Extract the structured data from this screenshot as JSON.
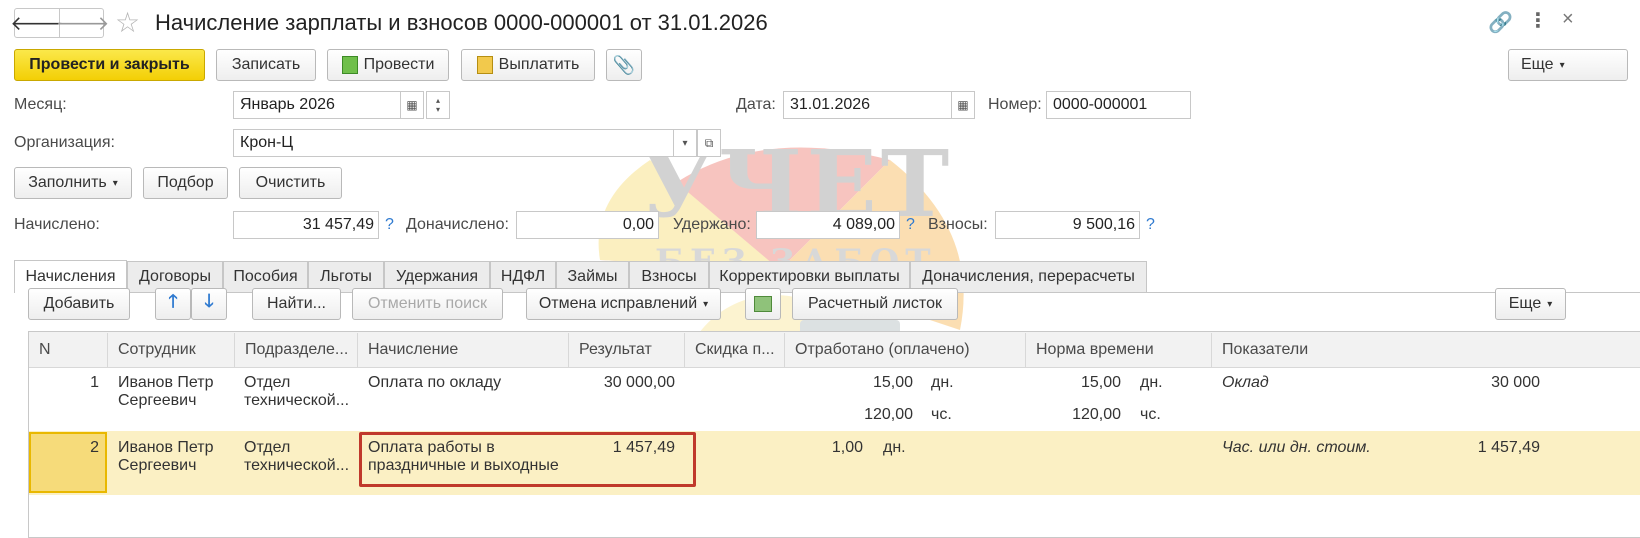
{
  "window": {
    "title": "Начисление зарплаты и взносов 0000-000001 от 31.01.2026"
  },
  "toolbar": {
    "post_close": "Провести и закрыть",
    "save": "Записать",
    "post": "Провести",
    "pay": "Выплатить",
    "more": "Еще"
  },
  "header": {
    "month_label": "Месяц:",
    "month_value": "Январь 2026",
    "date_label": "Дата:",
    "date_value": "31.01.2026",
    "number_label": "Номер:",
    "number_value": "0000-000001",
    "org_label": "Организация:",
    "org_value": "Крон-Ц"
  },
  "fill_bar": {
    "fill": "Заполнить",
    "select": "Подбор",
    "clear": "Очистить"
  },
  "totals": {
    "accrued_label": "Начислено:",
    "accrued_value": "31 457,49",
    "additional_label": "Доначислено:",
    "additional_value": "0,00",
    "withheld_label": "Удержано:",
    "withheld_value": "4 089,00",
    "contrib_label": "Взносы:",
    "contrib_value": "9 500,16",
    "help": "?"
  },
  "tabs": [
    "Начисления",
    "Договоры",
    "Пособия",
    "Льготы",
    "Удержания",
    "НДФЛ",
    "Займы",
    "Взносы",
    "Корректировки выплаты",
    "Доначисления, перерасчеты"
  ],
  "grid_toolbar": {
    "add": "Добавить",
    "find": "Найти...",
    "cancel_search": "Отменить поиск",
    "cancel_corrections": "Отмена исправлений",
    "payslip": "Расчетный листок",
    "more": "Еще"
  },
  "table": {
    "columns": [
      "N",
      "Сотрудник",
      "Подразделе...",
      "Начисление",
      "Результат",
      "Скидка п...",
      "Отработано (оплачено)",
      "Норма времени",
      "Показатели"
    ],
    "rows": [
      {
        "n": "1",
        "employee_1": "Иванов Петр",
        "employee_2": "Сергеевич",
        "dept_1": "Отдел",
        "dept_2": "технической...",
        "accrual_1": "Оплата по окладу",
        "accrual_2": "",
        "result": "30 000,00",
        "worked_1": "15,00",
        "worked_unit_1": "дн.",
        "worked_2": "120,00",
        "worked_unit_2": "чс.",
        "norm_1": "15,00",
        "norm_unit_1": "дн.",
        "norm_2": "120,00",
        "norm_unit_2": "чс.",
        "indicator": "Оклад",
        "indicator_value": "30 000"
      },
      {
        "n": "2",
        "employee_1": "Иванов Петр",
        "employee_2": "Сергеевич",
        "dept_1": "Отдел",
        "dept_2": "технической...",
        "accrual_1": "Оплата работы в",
        "accrual_2": "праздничные и выходные",
        "result": "1 457,49",
        "worked_1": "1,00",
        "worked_unit_1": "дн.",
        "indicator": "Час. или дн. стоим.",
        "indicator_value": "1 457,49"
      }
    ]
  },
  "watermark": {
    "line1": "УЧЕТ",
    "line2": "БЕЗ ЗАБОТ"
  },
  "colors": {
    "primary_button": "#f3cf05",
    "selected_row": "#fbf0c4",
    "selected_cell": "#f6db7a",
    "highlight_frame": "#c0392b",
    "link_blue": "#2f7ad0"
  }
}
